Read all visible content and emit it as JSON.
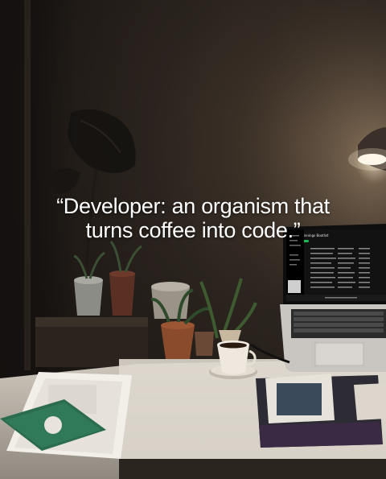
{
  "quote": {
    "line1": "“Developer: an organism that",
    "line2": "turns coffee into code.”"
  },
  "laptop_screen": {
    "header": "Beginnings Bootlist"
  },
  "colors": {
    "wall": "#2e2620",
    "lamp_glow": "#fff6e0",
    "desk": "#d8d2c8",
    "laptop_body": "#c9c6c2",
    "screen_bg": "#121212",
    "accent_green": "#1db954"
  }
}
